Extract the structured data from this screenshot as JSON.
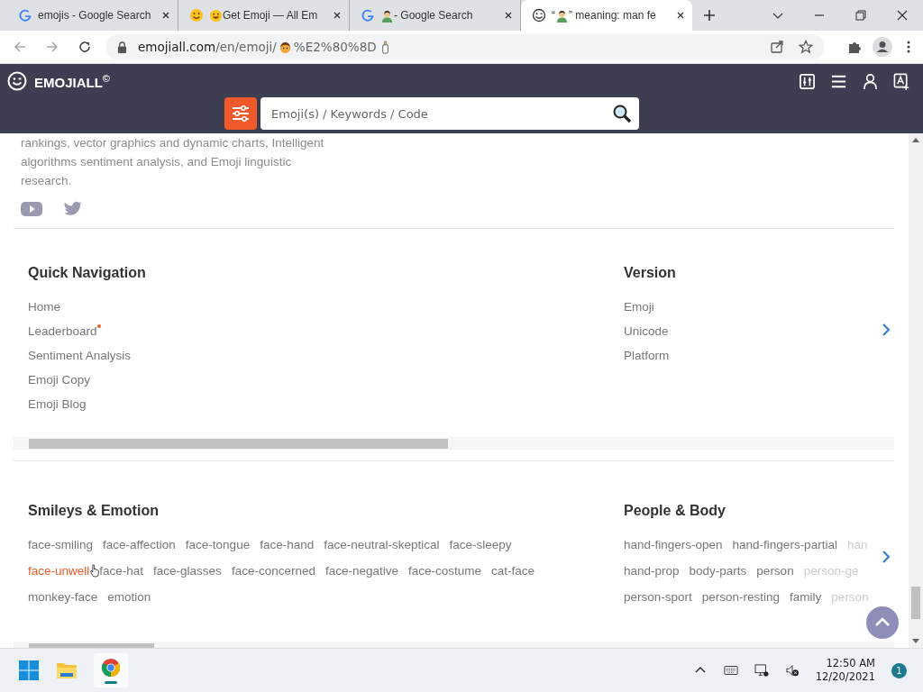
{
  "browser": {
    "tabs": [
      {
        "title": "emojis - Google Search",
        "selected": false
      },
      {
        "title": "Get Emoji — All Em",
        "selected": false
      },
      {
        "title": " - Google Search",
        "selected": false
      },
      {
        "title_start": "“",
        "title": "” meaning: man fe",
        "selected": true
      }
    ],
    "address": {
      "host": "emojiall.com",
      "path": "/en/emoji/",
      "middle": "%E2%80%8D"
    }
  },
  "site": {
    "logo": "EMOJIALL",
    "logo_mark": "©",
    "search": {
      "placeholder": "Emoji(s) / Keywords / Code"
    }
  },
  "intro": {
    "text": "rankings, vector graphics and dynamic charts, Intelligent algorithms sentiment analysis, and Emoji linguistic research."
  },
  "navigation": {
    "columns": [
      {
        "title": "Quick Navigation",
        "links": [
          {
            "label": "Home",
            "new": false
          },
          {
            "label": "Leaderboard",
            "new": true
          },
          {
            "label": "Sentiment Analysis",
            "new": false
          },
          {
            "label": "Emoji Copy",
            "new": false
          },
          {
            "label": "Emoji Blog",
            "new": false
          }
        ]
      },
      {
        "title": "Version",
        "links": [
          {
            "label": "Emoji",
            "new": false
          },
          {
            "label": "Unicode",
            "new": false
          },
          {
            "label": "Platform",
            "new": false
          }
        ]
      }
    ]
  },
  "categories": {
    "columns": [
      {
        "title": "Smileys & Emotion",
        "lines": [
          {
            "tags": [
              {
                "label": "face-smiling",
                "hovered": false
              },
              {
                "label": "face-affection",
                "hovered": false
              },
              {
                "label": "face-tongue",
                "hovered": false
              },
              {
                "label": "face-hand",
                "hovered": false
              },
              {
                "label": "face-neutral-skeptical",
                "hovered": false
              },
              {
                "label": "face-sleepy",
                "hovered": false
              }
            ]
          },
          {
            "tags": [
              {
                "label": "face-unwell",
                "hovered": true
              },
              {
                "label": "face-hat",
                "hovered": false
              },
              {
                "label": "face-glasses",
                "hovered": false
              },
              {
                "label": "face-concerned",
                "hovered": false
              },
              {
                "label": "face-negative",
                "hovered": false
              },
              {
                "label": "face-costume",
                "hovered": false
              },
              {
                "label": "cat-face",
                "hovered": false
              }
            ]
          },
          {
            "tags": [
              {
                "label": "monkey-face",
                "hovered": false
              },
              {
                "label": "emotion",
                "hovered": false
              }
            ]
          }
        ]
      },
      {
        "title": "People & Body",
        "lines": [
          {
            "tags": [
              {
                "label": "hand-fingers-open",
                "hovered": false
              },
              {
                "label": "hand-fingers-partial",
                "hovered": false
              },
              {
                "label": "han",
                "hovered": false
              }
            ]
          },
          {
            "tags": [
              {
                "label": "hand-prop",
                "hovered": false
              },
              {
                "label": "body-parts",
                "hovered": false
              },
              {
                "label": "person",
                "hovered": false
              },
              {
                "label": "person-ge",
                "hovered": false
              }
            ]
          },
          {
            "tags": [
              {
                "label": "person-sport",
                "hovered": false
              },
              {
                "label": "person-resting",
                "hovered": false
              },
              {
                "label": "family",
                "hovered": false
              },
              {
                "label": "person",
                "hovered": false
              }
            ]
          }
        ]
      }
    ]
  },
  "taskbar": {
    "time": "12:50 AM",
    "date": "12/20/2021",
    "notifications": "1"
  }
}
